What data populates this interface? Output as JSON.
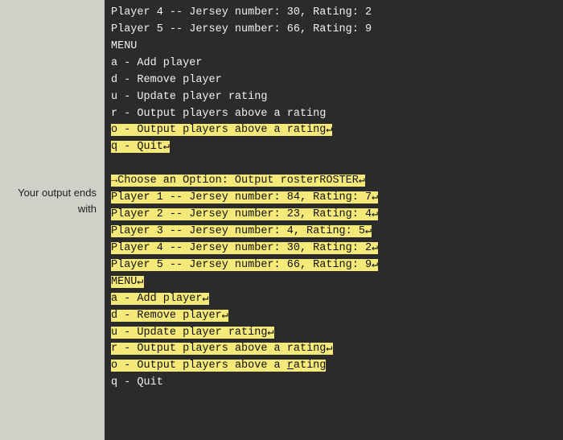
{
  "left_panel": {
    "line1": "Your output ends",
    "line2": "with"
  },
  "terminal": {
    "lines": [
      {
        "type": "plain",
        "text": "Player 4 -- Jersey number: 30, Rating: 2"
      },
      {
        "type": "plain",
        "text": "Player 5 -- Jersey number: 66, Rating: 9"
      },
      {
        "type": "plain",
        "text": "MENU"
      },
      {
        "type": "plain",
        "text": "a - Add player"
      },
      {
        "type": "plain",
        "text": "d - Remove player"
      },
      {
        "type": "plain",
        "text": "u - Update player rating"
      },
      {
        "type": "plain",
        "text": "r - Output players above a rating"
      },
      {
        "type": "highlight",
        "text": "o - Output players above a rating"
      },
      {
        "type": "highlight-end",
        "text": "q - Quit"
      },
      {
        "type": "plain",
        "text": ""
      },
      {
        "type": "mixed-prompt",
        "text": ""
      },
      {
        "type": "plain-player1",
        "text": ""
      },
      {
        "type": "plain-player2",
        "text": ""
      },
      {
        "type": "plain-player3",
        "text": ""
      },
      {
        "type": "plain-player4",
        "text": ""
      },
      {
        "type": "plain-player5",
        "text": ""
      },
      {
        "type": "menu2",
        "text": ""
      },
      {
        "type": "menu-a",
        "text": ""
      },
      {
        "type": "menu-d",
        "text": ""
      },
      {
        "type": "menu-u",
        "text": ""
      },
      {
        "type": "menu-r",
        "text": ""
      },
      {
        "type": "menu-o",
        "text": ""
      },
      {
        "type": "menu-q",
        "text": ""
      }
    ]
  }
}
